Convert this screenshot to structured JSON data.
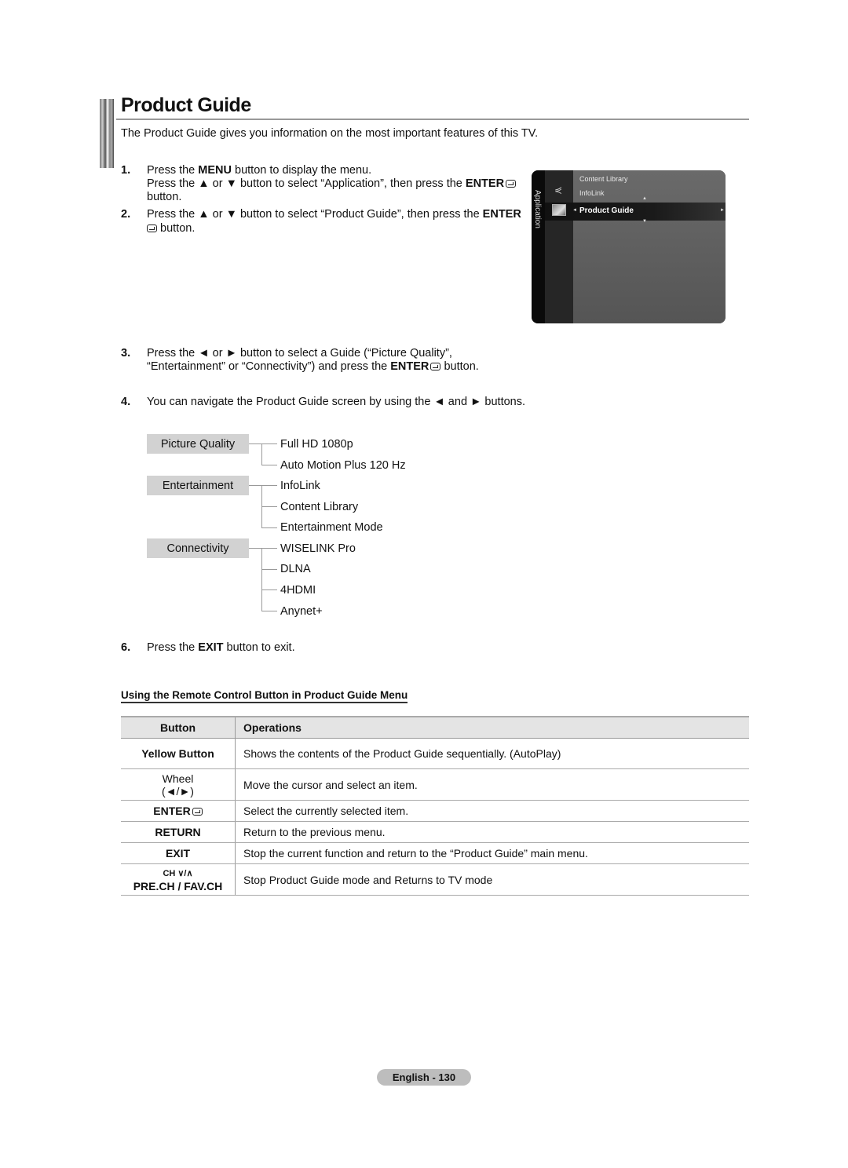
{
  "page": {
    "title": "Product Guide",
    "intro": "The Product Guide gives you information on the most important features of this TV."
  },
  "steps": [
    {
      "num": "1.",
      "lines": [
        {
          "parts": [
            "Press the ",
            "MENU",
            " button to display the menu."
          ]
        },
        {
          "parts": [
            "Press the ▲ or ▼ button to select “Application”, then press the ",
            "ENTER",
            ""
          ]
        },
        {
          "parts": [
            "button."
          ]
        }
      ]
    },
    {
      "num": "2.",
      "lines": [
        {
          "parts": [
            "Press the ▲ or ▼ button to select “Product Guide”, then press the ",
            "ENTER"
          ]
        },
        {
          "parts": [
            " button."
          ]
        }
      ]
    },
    {
      "num": "3.",
      "lines": [
        {
          "parts": [
            "Press the ◄ or ► button to select a Guide (“Picture Quality”,"
          ]
        },
        {
          "parts": [
            "“Entertainment” or “Connectivity”) and press the ",
            "ENTER",
            " button."
          ]
        }
      ]
    },
    {
      "num": "4.",
      "text": "You can navigate the Product Guide screen by using the ◄ and ► buttons."
    },
    {
      "num": "6.",
      "parts": [
        "Press the ",
        "EXIT",
        " button to exit."
      ]
    }
  ],
  "tv_menu": {
    "side_label": "Application",
    "items": [
      "Content Library",
      "InfoLink"
    ],
    "selected": "Product Guide"
  },
  "guide_tree": [
    {
      "category": "Picture Quality",
      "items": [
        "Full HD 1080p",
        "Auto Motion Plus 120 Hz"
      ]
    },
    {
      "category": "Entertainment",
      "items": [
        "InfoLink",
        "Content Library",
        "Entertainment Mode"
      ]
    },
    {
      "category": "Connectivity",
      "items": [
        "WISELINK Pro",
        "DLNA",
        "4HDMI",
        "Anynet+"
      ]
    }
  ],
  "remote_section": {
    "heading": "Using the Remote Control Button in Product Guide Menu",
    "columns": [
      "Button",
      "Operations"
    ],
    "rows": [
      {
        "button": "Yellow Button",
        "operation": "Shows the contents of the Product Guide sequentially. (AutoPlay)"
      },
      {
        "button": "Wheel",
        "button_sub": "(◄/►)",
        "operation": "Move the cursor and select an item."
      },
      {
        "button": "ENTER",
        "operation": "Select the currently selected item."
      },
      {
        "button": "RETURN",
        "operation": "Return to the previous menu."
      },
      {
        "button": "EXIT",
        "operation": "Stop the current function and return to the “Product Guide” main menu."
      },
      {
        "button": "CH ∨/∧",
        "button_sub": "PRE.CH / FAV.CH",
        "operation": "Stop Product Guide mode and Returns to TV mode"
      }
    ]
  },
  "footer": {
    "label": "English - 130"
  }
}
